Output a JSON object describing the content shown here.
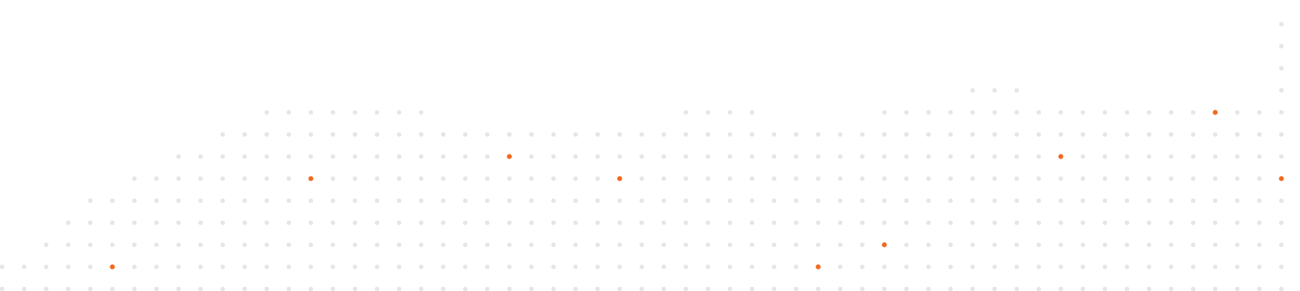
{
  "colors": {
    "background": "#ffffff",
    "dot": "#e6e6e6",
    "accent_dot": "#f26a21"
  },
  "grid": {
    "column_count": 60,
    "row_count": 14,
    "column_top_rows": [
      12,
      12,
      11,
      10,
      9,
      9,
      8,
      8,
      7,
      7,
      6,
      6,
      5,
      5,
      5,
      5,
      5,
      5,
      5,
      5,
      6,
      6,
      6,
      6,
      6,
      6,
      6,
      6,
      6,
      6,
      6,
      5,
      5,
      5,
      5,
      6,
      6,
      6,
      6,
      6,
      5,
      5,
      5,
      5,
      4,
      4,
      4,
      5,
      5,
      5,
      5,
      5,
      5,
      5,
      5,
      5,
      5,
      5,
      1,
      1
    ],
    "accent_dots": [
      {
        "col": 5,
        "row": 12
      },
      {
        "col": 11,
        "row": 5
      },
      {
        "col": 14,
        "row": 8
      },
      {
        "col": 23,
        "row": 7
      },
      {
        "col": 27,
        "row": 4
      },
      {
        "col": 28,
        "row": 8
      },
      {
        "col": 37,
        "row": 12
      },
      {
        "col": 40,
        "row": 11
      },
      {
        "col": 48,
        "row": 7
      },
      {
        "col": 55,
        "row": 5
      },
      {
        "col": 58,
        "row": 8
      }
    ]
  }
}
